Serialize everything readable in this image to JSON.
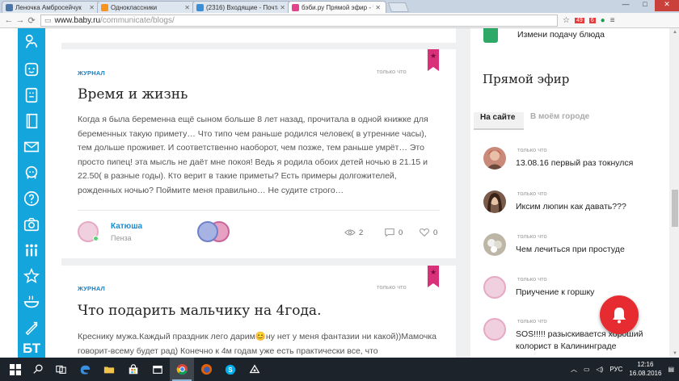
{
  "browser": {
    "tabs": [
      {
        "label": "Леночка Амбросейчук",
        "icon_color": "#4a76a8",
        "icon": "vk-icon"
      },
      {
        "label": "Одноклассники",
        "icon_color": "#f7931e",
        "icon": "ok-icon"
      },
      {
        "label": "(2316) Входящие - Почта",
        "icon_color": "#3a8fd8",
        "icon": "mail-icon"
      },
      {
        "label": "бэби.ру Прямой эфир - Ч",
        "icon_color": "#e4428c",
        "icon": "baby-icon",
        "active": true
      }
    ],
    "url_host": "www.baby.ru",
    "url_path": "/communicate/blogs/",
    "window_controls": {
      "min": "—",
      "max": "□",
      "close": "✕"
    },
    "ext_badges": [
      "49",
      "6"
    ]
  },
  "feed": [
    {
      "category": "ЖУРНАЛ",
      "time": "только что",
      "title": "Время и жизнь",
      "body": "Когда я была беременна ещё сыном больше 8 лет назад, прочитала в одной книжке для беременных такую примету… Что типо чем раньше родился человек( в утренние часы), тем дольше проживет. И соответственно наоборот, чем позже, тем раньше умрёт… Это просто пипец! эта мысль не даёт мне покоя! Ведь я родила обоих детей ночью в 21.15 и 22.50( в разные годы). Кто верит в такие приметы? Есть примеры долгожителей, рожденных ночью? Поймите меня правильно… Не судите строго…",
      "author": "Катюша",
      "city": "Пенза",
      "views": "2",
      "comments": "0",
      "likes": "0"
    },
    {
      "category": "ЖУРНАЛ",
      "time": "только что",
      "title": "Что подарить мальчику на 4года.",
      "body": "Креснику мужа.Каждый праздник лего дарим😊ну нет у меня фантазии ни какой))Мамочка говорит-всему будет рад) Конечно к 4м годам уже есть практически все, что"
    }
  ],
  "right": {
    "promo": "Измени подачу блюда",
    "heading": "Прямой эфир",
    "tab_active": "На сайте",
    "tab_inactive": "В моём городе",
    "items": [
      {
        "time": "только что",
        "text": "13.08.16 первый раз токнулся",
        "avatar_color": "#c98a7a"
      },
      {
        "time": "только что",
        "text": "Иксим люпин как давать???",
        "avatar_color": "#7a5a4a"
      },
      {
        "time": "только что",
        "text": "Чем лечиться при простуде",
        "avatar_color": "#a8a090"
      },
      {
        "time": "только что",
        "text": "Приучение к горшку",
        "avatar_color": "#f0d0df"
      },
      {
        "time": "только что",
        "text": "SOS!!!!! разыскивается хороший колорист в Калининграде",
        "avatar_color": "#f0d0df"
      }
    ]
  },
  "sidebar_text_icon": "БТ",
  "taskbar": {
    "lang": "РУС",
    "time": "12:16",
    "date": "16.08.2016"
  },
  "colors": {
    "brand_blue": "#14a5dc",
    "ribbon_pink": "#d9307a",
    "link_blue": "#1a8ccd",
    "bell_red": "#e62c30"
  }
}
